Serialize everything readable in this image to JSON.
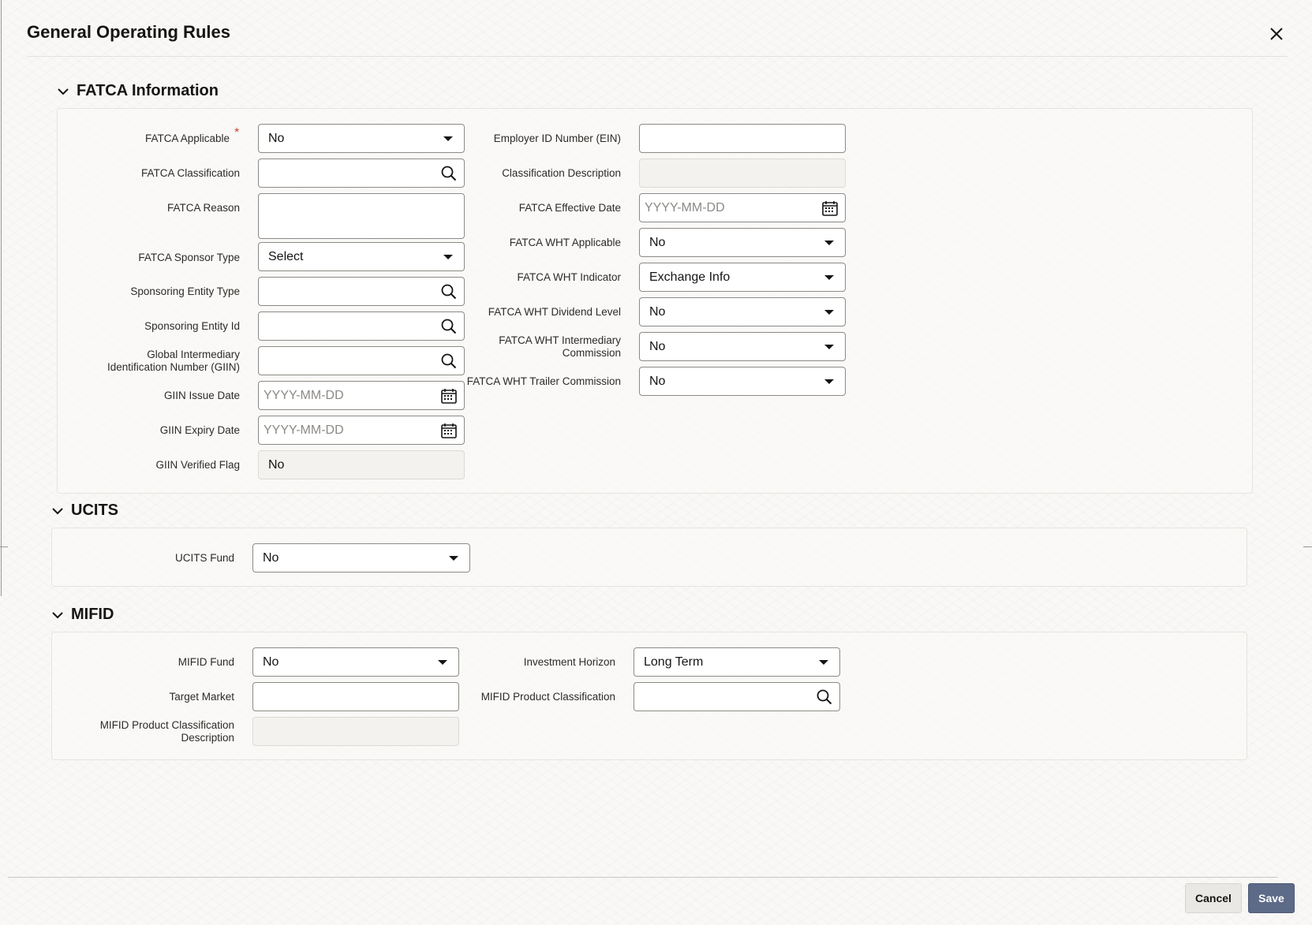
{
  "dialog": {
    "title": "General Operating Rules"
  },
  "sections": {
    "fatca": {
      "title": "FATCA Information",
      "fatca_applicable": {
        "label": "FATCA Applicable",
        "value": "No"
      },
      "fatca_classification": {
        "label": "FATCA Classification",
        "value": ""
      },
      "fatca_reason": {
        "label": "FATCA Reason",
        "value": ""
      },
      "fatca_sponsor_type": {
        "label": "FATCA Sponsor Type",
        "value": "Select"
      },
      "sponsoring_entity_type": {
        "label": "Sponsoring Entity Type",
        "value": ""
      },
      "sponsoring_entity_id": {
        "label": "Sponsoring Entity Id",
        "value": ""
      },
      "giin": {
        "label_line1": "Global Intermediary",
        "label_line2": "Identification Number (GIIN)",
        "value": ""
      },
      "giin_issue_date": {
        "label": "GIIN Issue Date",
        "placeholder": "YYYY-MM-DD"
      },
      "giin_expiry_date": {
        "label": "GIIN Expiry Date",
        "placeholder": "YYYY-MM-DD"
      },
      "giin_verified_flag": {
        "label": "GIIN Verified Flag",
        "value": "No"
      },
      "employer_id": {
        "label": "Employer ID Number (EIN)",
        "value": ""
      },
      "classification_description": {
        "label": "Classification Description",
        "value": ""
      },
      "fatca_effective_date": {
        "label": "FATCA Effective Date",
        "placeholder": "YYYY-MM-DD"
      },
      "wht_applicable": {
        "label": "FATCA WHT Applicable",
        "value": "No"
      },
      "wht_indicator": {
        "label": "FATCA WHT Indicator",
        "value": "Exchange Info"
      },
      "wht_dividend_level": {
        "label": "FATCA WHT Dividend Level",
        "value": "No"
      },
      "wht_intermediary_commission": {
        "label_line1": "FATCA WHT Intermediary",
        "label_line2": "Commission",
        "value": "No"
      },
      "wht_trailer_commission": {
        "label": "FATCA WHT Trailer Commission",
        "value": "No"
      }
    },
    "ucits": {
      "title": "UCITS",
      "ucits_fund": {
        "label": "UCITS Fund",
        "value": "No"
      }
    },
    "mifid": {
      "title": "MIFID",
      "mifid_fund": {
        "label": "MIFID Fund",
        "value": "No"
      },
      "target_market": {
        "label": "Target Market",
        "value": ""
      },
      "product_class_desc": {
        "label_line1": "MIFID Product Classification",
        "label_line2": "Description",
        "value": ""
      },
      "investment_horizon": {
        "label": "Investment Horizon",
        "value": "Long Term"
      },
      "product_classification": {
        "label": "MIFID Product Classification",
        "value": ""
      }
    }
  },
  "footer": {
    "cancel_label": "Cancel",
    "save_label": "Save"
  },
  "colors": {
    "required": "#c74634",
    "save_button": "#5d6a88",
    "border": "#8c8a86"
  }
}
